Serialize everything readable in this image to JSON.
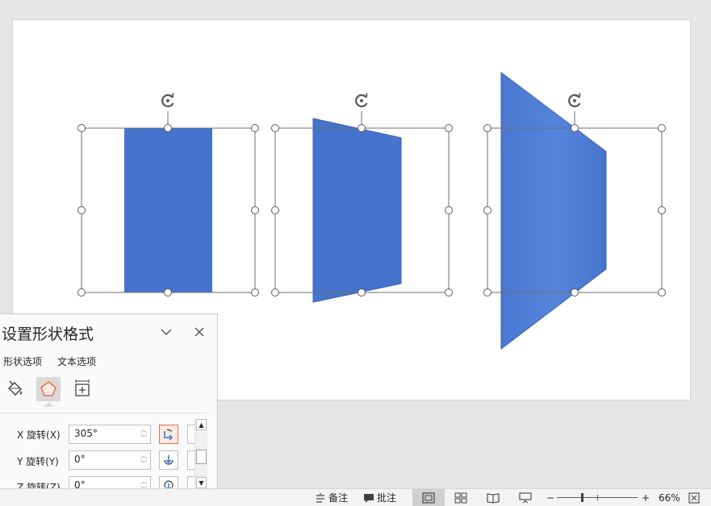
{
  "panel": {
    "title": "设置形状格式",
    "tabs": [
      "形状选项",
      "文本选项"
    ],
    "rows": [
      {
        "label": "X 旋转(X)",
        "value": "305°"
      },
      {
        "label": "Y 旋转(Y)",
        "value": "0°"
      },
      {
        "label": "Z 旋转(Z)",
        "value": "0°"
      }
    ],
    "icons": {
      "collapse": "chevron-down-icon",
      "close": "close-icon",
      "fill_line": "paint-bucket-icon",
      "effects": "pentagon-icon",
      "size_props": "size-properties-icon"
    }
  },
  "status": {
    "notes_label": "备注",
    "comments_label": "批注",
    "zoom_level": "66%",
    "zoom_minus": "−",
    "zoom_plus": "+"
  },
  "colors": {
    "shape_fill": "#4674cc",
    "shape_stroke": "#3a62b2",
    "accent": "#e07050"
  }
}
